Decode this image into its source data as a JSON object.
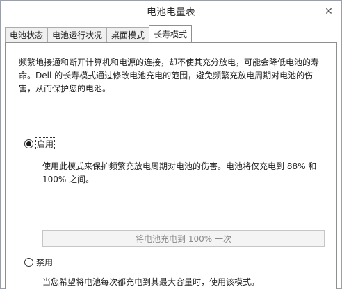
{
  "window": {
    "title": "电池电量表",
    "close_glyph": "✕"
  },
  "tabs": [
    {
      "label": "电池状态",
      "active": false
    },
    {
      "label": "电池运行状况",
      "active": false
    },
    {
      "label": "桌面模式",
      "active": false
    },
    {
      "label": "长寿模式",
      "active": true
    }
  ],
  "longevity": {
    "description": "频繁地接通和断开计算机和电源的连接，却不使其充分放电，可能会降低电池的寿命。Dell 的长寿模式通过修改电池充电的范围，避免频繁充放电周期对电池的伤害，从而保护您的电池。",
    "enable": {
      "label": "启用",
      "selected": true,
      "description": "使用此模式来保护频繁充放电周期对电池的伤害。电池将仅充电到 88% 和 100% 之间。"
    },
    "charge_button_label": "将电池充电到 100% 一次",
    "disable": {
      "label": "禁用",
      "selected": false,
      "description": "当您希望将电池每次都充电到其最大容量时，使用该模式。"
    }
  }
}
